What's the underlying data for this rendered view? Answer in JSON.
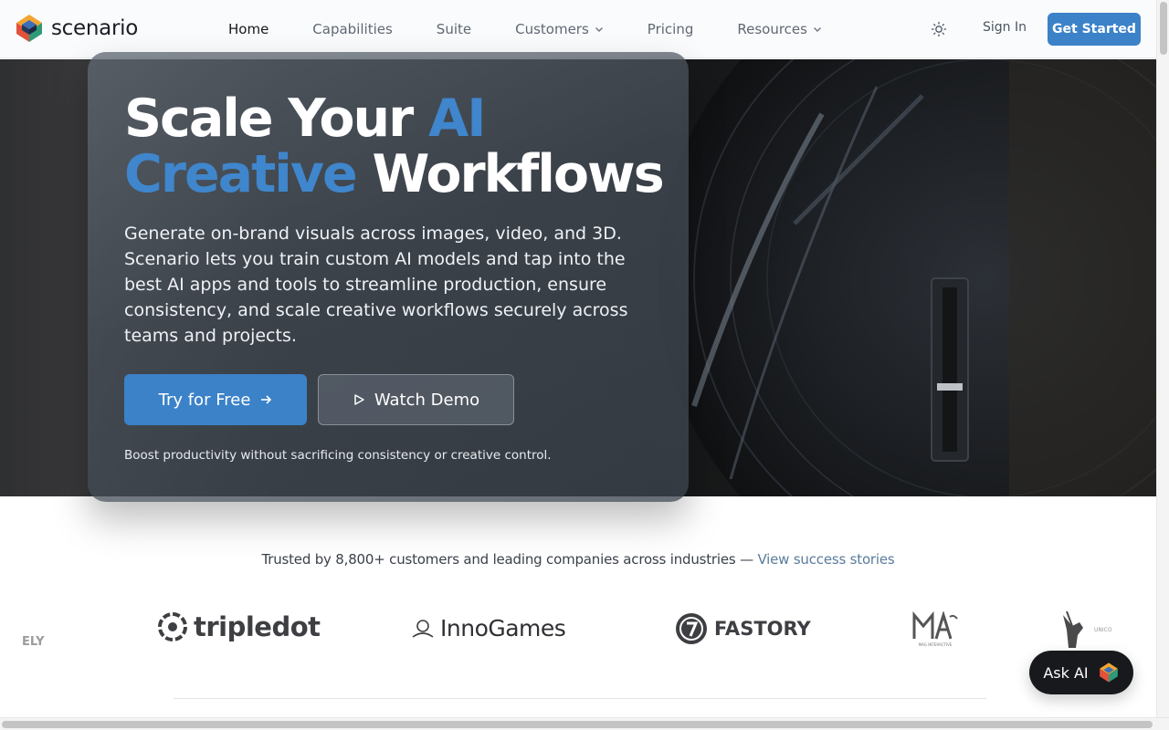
{
  "brand": {
    "name": "scenario"
  },
  "nav": {
    "links": [
      {
        "label": "Home"
      },
      {
        "label": "Capabilities"
      },
      {
        "label": "Suite"
      },
      {
        "label": "Customers"
      },
      {
        "label": "Pricing"
      },
      {
        "label": "Resources"
      }
    ],
    "sign_in": "Sign In",
    "get_started": "Get Started"
  },
  "hero": {
    "headline_part1": "Scale Your ",
    "headline_part2": "AI",
    "headline_part3": "Creative",
    "headline_part4": " Workflows",
    "subtitle": "Generate on-brand visuals across images, video, and 3D. Scenario lets you train custom AI models and tap into the best AI apps and tools to streamline production, ensure consistency, and scale creative workflows securely across teams and projects.",
    "try_free": "Try for Free",
    "watch_demo": "Watch Demo",
    "tagline": "Boost productivity without sacrificing consistency or creative control."
  },
  "trust": {
    "text": "Trusted by 8,800+ customers and leading companies across industries — ",
    "link": "View success stories",
    "logos": [
      {
        "label": "ELY"
      },
      {
        "label": "tripledot"
      },
      {
        "label": "InnoGames"
      },
      {
        "label": "FASTORY"
      },
      {
        "label": "MAG INTERACTIVE"
      },
      {
        "label": "UNICO"
      }
    ]
  },
  "ask_ai": "Ask AI",
  "colors": {
    "accent": "#3b82c8",
    "headline_blue": "#3f86cc",
    "dark": "#17191d"
  },
  "icons": [
    "logo-mark-icon",
    "chevron-down-icon",
    "sun-icon",
    "arrow-right-icon",
    "play-icon"
  ]
}
